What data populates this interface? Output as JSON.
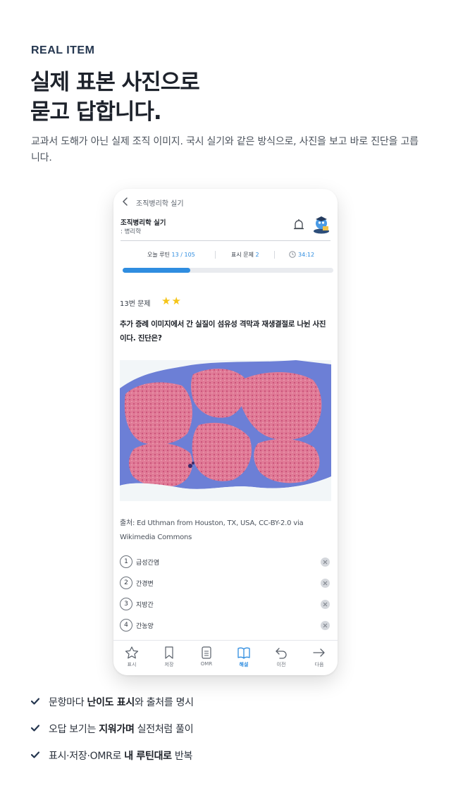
{
  "section": {
    "eyebrow": "REAL ITEM",
    "headline_line1": "실제 표본 사진으로",
    "headline_line2": "묻고 답합니다.",
    "description": "교과서 도해가 아닌 실제 조직 이미지. 국시 실기와 같은 방식으로, 사진을 보고 바로 진단을 고릅니다."
  },
  "app": {
    "topbar_title": "조직병리학 실기",
    "subject_title": "조직병리학 실기",
    "subject_sub": ": 병리학",
    "stats": {
      "today_label": "오늘 루틴",
      "today_value": "13 / 105",
      "marked_label": "표시 문제",
      "marked_value": "2",
      "timer": "34:12"
    },
    "progress": 0.32,
    "question": {
      "number": "13번 문제",
      "difficulty_stars": "★★",
      "text": "추가 증례 이미지에서 간 실질이 섬유성 격막과 재생결절로 나뉜 사진이다. 진단은?",
      "source": "출처: Ed Uthman from Houston, TX, USA, CC-BY-2.0 via Wikimedia Commons"
    },
    "options": [
      {
        "num": "1",
        "label": "급성간염"
      },
      {
        "num": "2",
        "label": "간경변"
      },
      {
        "num": "3",
        "label": "지방간"
      },
      {
        "num": "4",
        "label": "간농양"
      }
    ],
    "nav": {
      "mark": "표시",
      "save": "저장",
      "omr": "OMR",
      "explain": "해설",
      "prev": "이전",
      "next": "다음"
    }
  },
  "features": {
    "f1_pre": "문항마다 ",
    "f1_bold": "난이도 표시",
    "f1_post": "와 출처를 명시",
    "f2_pre": "오답 보기는 ",
    "f2_bold": "지워가며",
    "f2_post": " 실전처럼 풀이",
    "f3_pre": "표시·저장·OMR로 ",
    "f3_bold": "내 루틴대로",
    "f3_post": " 반복"
  },
  "colors": {
    "accent": "#2f8de0",
    "star": "#f5c518",
    "tissue_pink": "#e0708f",
    "fibrosis_blue": "#6c7fd6"
  }
}
